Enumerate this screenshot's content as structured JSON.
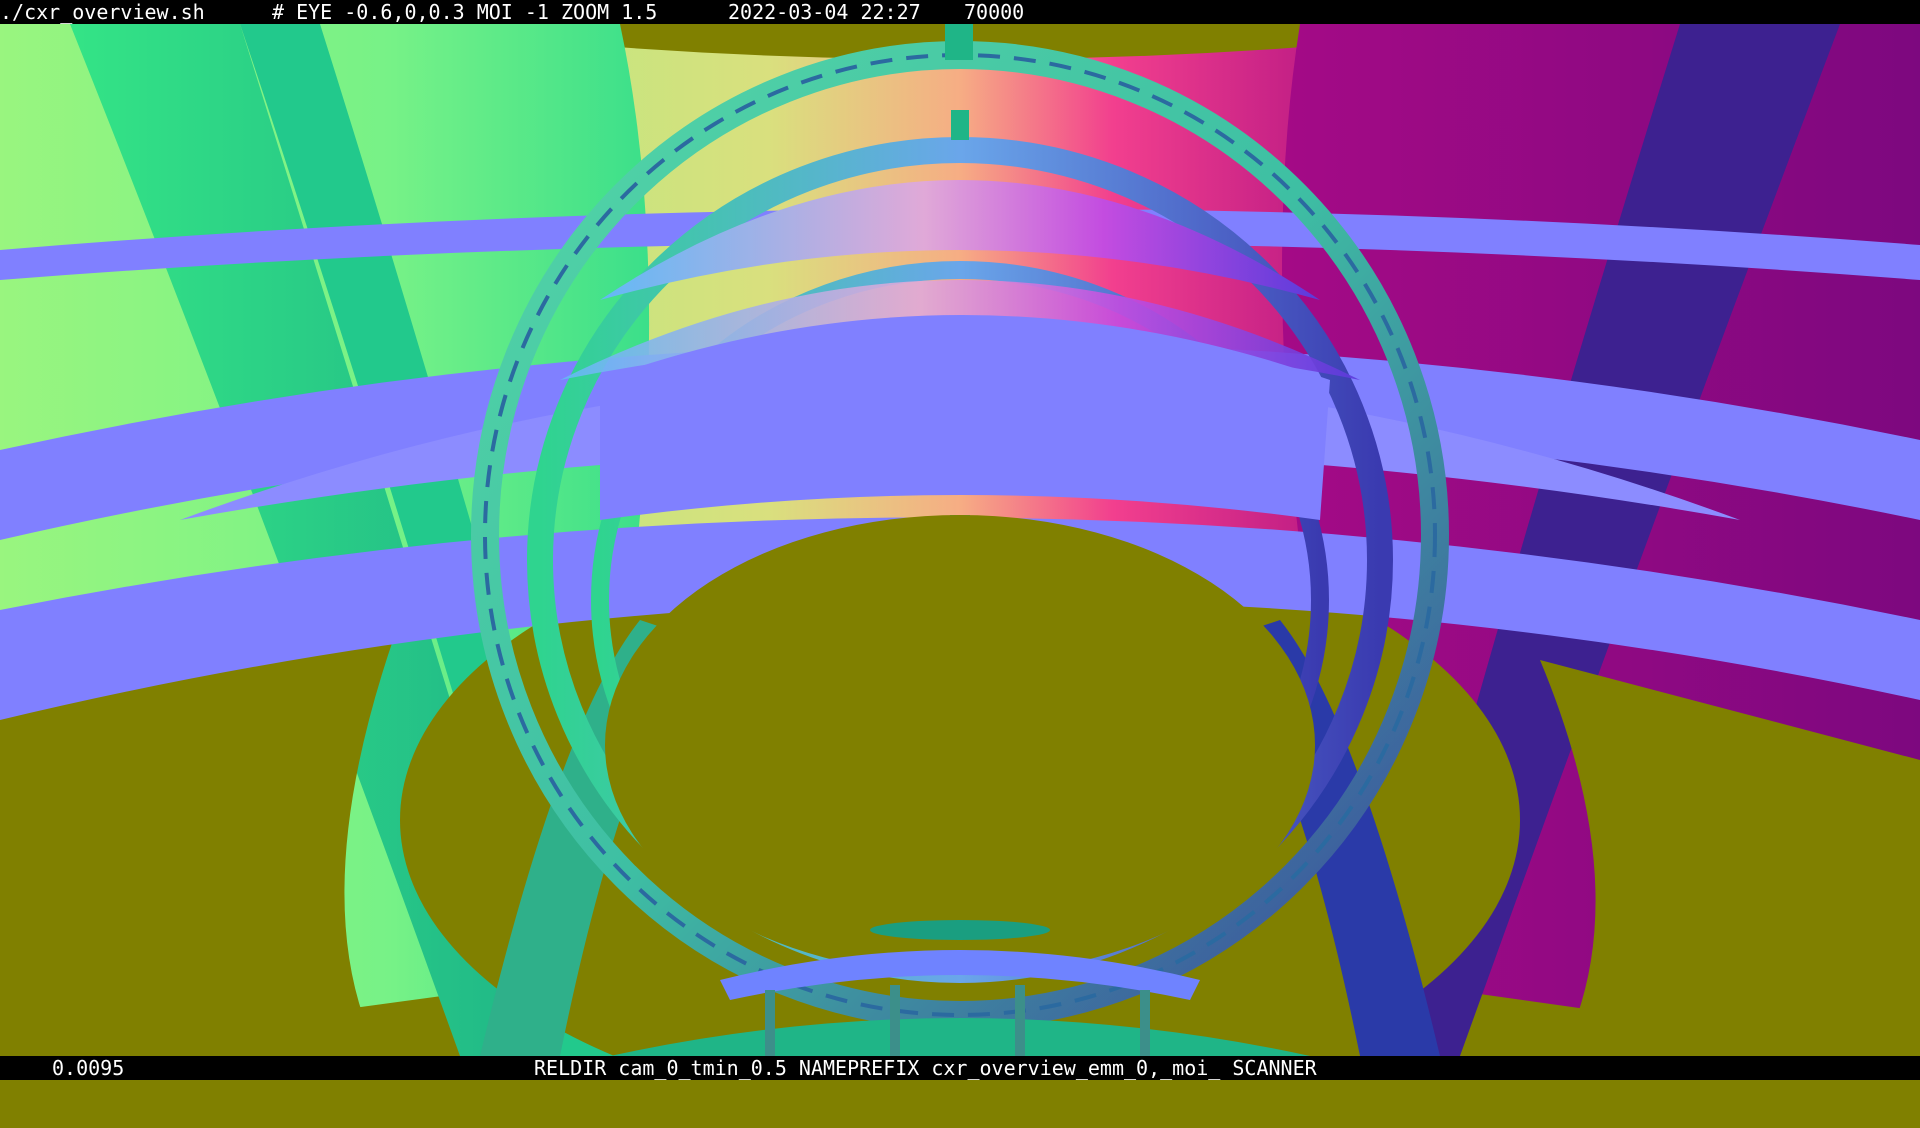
{
  "window": {
    "script_name": "./cxr_overview.sh",
    "header_params": "# EYE -0.6,0,0.3 MOI -1 ZOOM 1.5",
    "timestamp": "2022-03-04 22:27",
    "frame_count": "70000"
  },
  "footer": {
    "time_value": "0.0095",
    "info": "RELDIR cam_0_tmin_0.5 NAMEPREFIX cxr_overview_emm_0,_moi_ SCANNER"
  },
  "colors": {
    "background": "#808000",
    "slab": "#8080ff",
    "green": "#99f57f",
    "magenta": "#84087f",
    "accent_teal": "#1fb587",
    "dark_blue": "#3d3f9c"
  },
  "scene": {
    "type": "3d-render-normal-shaded",
    "objects": [
      "outer-cylinder-walls",
      "horizontal-slabs",
      "scanner-ring",
      "vertical-rod",
      "support-legs"
    ]
  }
}
